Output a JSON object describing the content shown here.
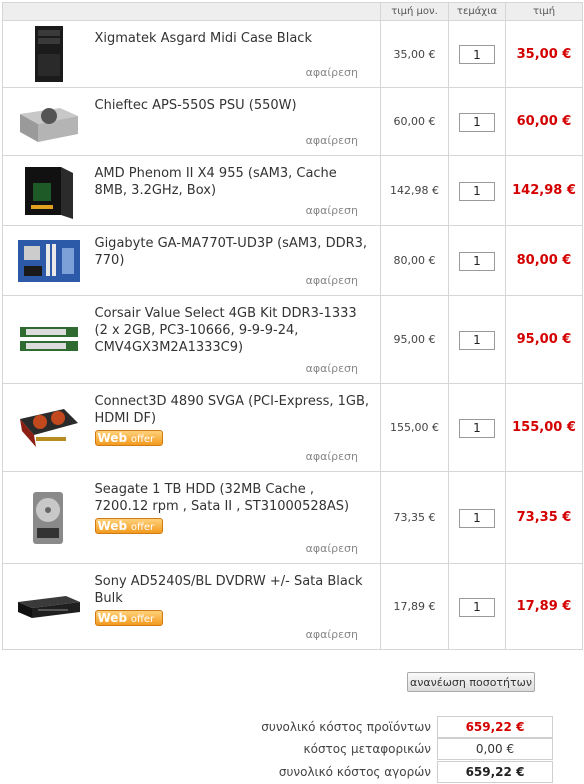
{
  "headers": {
    "unit_price": "τιμή μον.",
    "quantity": "τεμάχια",
    "price": "τιμή"
  },
  "remove_label": "αφαίρεση",
  "offer_badge": {
    "web": "Web",
    "offer": "offer"
  },
  "items": [
    {
      "name": "Xigmatek Asgard Midi Case Black",
      "unit_price": "35,00 €",
      "qty": "1",
      "total": "35,00 €",
      "icon": "pc-case-icon",
      "offer": false
    },
    {
      "name": "Chieftec APS-550S PSU (550W)",
      "unit_price": "60,00 €",
      "qty": "1",
      "total": "60,00 €",
      "icon": "power-supply-icon",
      "offer": false
    },
    {
      "name": "AMD Phenom II X4 955 (sAM3, Cache 8MB, 3.2GHz, Box)",
      "unit_price": "142,98 €",
      "qty": "1",
      "total": "142,98 €",
      "icon": "cpu-box-icon",
      "offer": false
    },
    {
      "name": "Gigabyte GA-MA770T-UD3P (sAM3, DDR3, 770)",
      "unit_price": "80,00 €",
      "qty": "1",
      "total": "80,00 €",
      "icon": "motherboard-icon",
      "offer": false
    },
    {
      "name": "Corsair Value Select 4GB Kit DDR3-1333 (2 x 2GB, PC3-10666, 9-9-9-24, CMV4GX3M2A1333C9)",
      "unit_price": "95,00 €",
      "qty": "1",
      "total": "95,00 €",
      "icon": "ram-icon",
      "offer": false
    },
    {
      "name": "Connect3D 4890 SVGA (PCI-Express, 1GB, HDMI DF)",
      "unit_price": "155,00 €",
      "qty": "1",
      "total": "155,00 €",
      "icon": "graphics-card-icon",
      "offer": true
    },
    {
      "name": "Seagate 1 TB HDD (32MB Cache , 7200.12 rpm , Sata II , ST31000528AS)",
      "unit_price": "73,35 €",
      "qty": "1",
      "total": "73,35 €",
      "icon": "hard-drive-icon",
      "offer": true
    },
    {
      "name": "Sony AD5240S/BL DVDRW +/- Sata Black Bulk",
      "unit_price": "17,89 €",
      "qty": "1",
      "total": "17,89 €",
      "icon": "dvd-drive-icon",
      "offer": true
    }
  ],
  "update_button": "ανανέωση ποσοτήτων",
  "summary": {
    "products_label": "συνολικό κόστος προϊόντων",
    "products_value": "659,22 €",
    "shipping_label": "κόστος μεταφορικών",
    "shipping_value": "0,00 €",
    "total_label": "συνολικό κόστος αγορών",
    "total_value": "659,22 €"
  },
  "colors": {
    "accent_red": "#d40000",
    "border": "#d6d6d6",
    "header_bg": "#eeeeee"
  }
}
